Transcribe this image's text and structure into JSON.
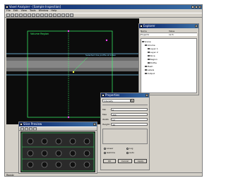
{
  "main_window": {
    "title": "Voxel Analyzer - [Sample Inspection]",
    "menu": [
      "File",
      "Edit",
      "View",
      "Tools",
      "Window",
      "Help"
    ],
    "toolbar_icons": [
      "new-icon",
      "open-icon",
      "save-icon",
      "print-icon",
      "cut-icon",
      "copy-icon",
      "paste-icon",
      "undo-icon",
      "zoom-in-icon",
      "zoom-out-icon",
      "pan-icon",
      "select-icon",
      "measure-icon",
      "ruler-icon",
      "grid-icon",
      "settings-icon"
    ],
    "status": "Ready",
    "viewport": {
      "annotation_1": "Volume Region",
      "annotation_2": "Selected line profile at index"
    }
  },
  "tree_panel": {
    "title": "Explorer",
    "header_cols": [
      "Name",
      "Value"
    ],
    "header_values": [
      "Project1",
      "12.5"
    ],
    "items": [
      "Scene",
      "Volume",
      "Layer 1",
      "Layer 2",
      "Slice",
      "Region",
      "Profile",
      "Mesh",
      "Labels",
      "Output"
    ]
  },
  "props_dialog": {
    "title": "Properties",
    "dropdown_value": "Intensity",
    "fields": [
      {
        "label": "Min",
        "value": "0"
      },
      {
        "label": "Max",
        "value": "255"
      },
      {
        "label": "Width",
        "value": "12"
      },
      {
        "label": "Height",
        "value": "40"
      }
    ],
    "radios": [
      "Linear",
      "Log",
      "Gamma",
      "Auto"
    ],
    "buttons": [
      "OK",
      "Cancel",
      "Apply"
    ]
  },
  "thumb_window": {
    "title": "Slice Preview"
  }
}
